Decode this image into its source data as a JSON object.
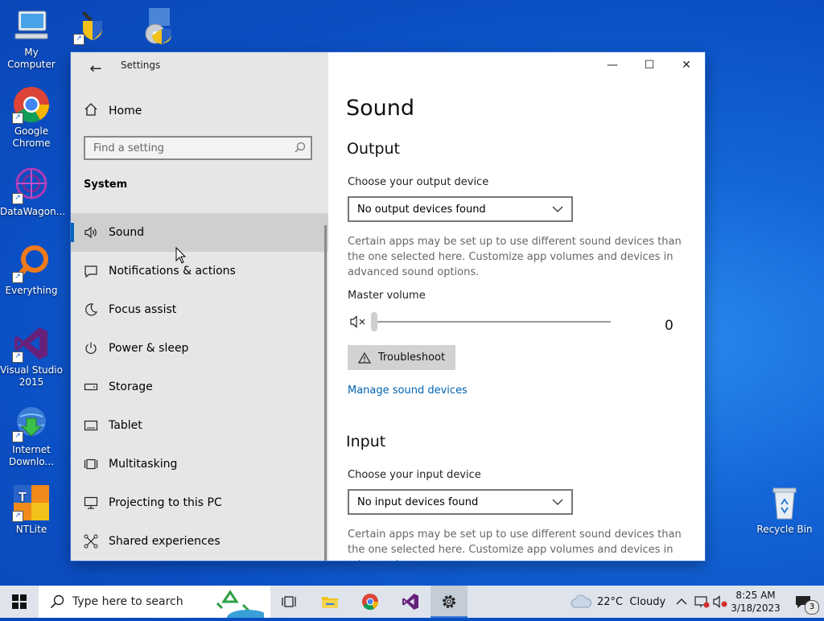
{
  "desktop": {
    "icons": [
      {
        "label": "My Computer"
      },
      {
        "label": "Google\nChrome"
      },
      {
        "label": "DataWagon..."
      },
      {
        "label": "Everything"
      },
      {
        "label": "Visual Studio\n2015"
      },
      {
        "label": "Internet\nDownlo..."
      },
      {
        "label": "NTLite"
      },
      {
        "label": "Recycle Bin"
      }
    ]
  },
  "window": {
    "title": "Settings",
    "controls": {
      "minimize": "—",
      "maximize": "☐",
      "close": "✕"
    }
  },
  "sidebar": {
    "home_label": "Home",
    "search_placeholder": "Find a setting",
    "section_label": "System",
    "items": [
      {
        "label": "Sound",
        "icon": "speaker-icon",
        "selected": true
      },
      {
        "label": "Notifications & actions",
        "icon": "notification-icon"
      },
      {
        "label": "Focus assist",
        "icon": "moon-icon"
      },
      {
        "label": "Power & sleep",
        "icon": "power-icon"
      },
      {
        "label": "Storage",
        "icon": "storage-icon"
      },
      {
        "label": "Tablet",
        "icon": "tablet-icon"
      },
      {
        "label": "Multitasking",
        "icon": "multitasking-icon"
      },
      {
        "label": "Projecting to this PC",
        "icon": "projector-icon"
      },
      {
        "label": "Shared experiences",
        "icon": "share-icon"
      }
    ]
  },
  "content": {
    "page_title": "Sound",
    "output": {
      "heading": "Output",
      "device_label": "Choose your output device",
      "device_value": "No output devices found",
      "description": "Certain apps may be set up to use different sound devices than the one selected here. Customize app volumes and devices in advanced sound options.",
      "volume_label": "Master volume",
      "volume_value": "0",
      "troubleshoot_label": "Troubleshoot",
      "manage_link": "Manage sound devices"
    },
    "input": {
      "heading": "Input",
      "device_label": "Choose your input device",
      "device_value": "No input devices found",
      "description": "Certain apps may be set up to use different sound devices than the one selected here. Customize app volumes and devices in advanced"
    }
  },
  "taskbar": {
    "search_placeholder": "Type here to search",
    "weather": "22°C  Cloudy",
    "time": "8:25 AM",
    "date": "3/18/2023",
    "notification_count": "3"
  },
  "colors": {
    "accent": "#0067c0",
    "link": "#0063b1",
    "desktop": "#0b4fc4"
  }
}
